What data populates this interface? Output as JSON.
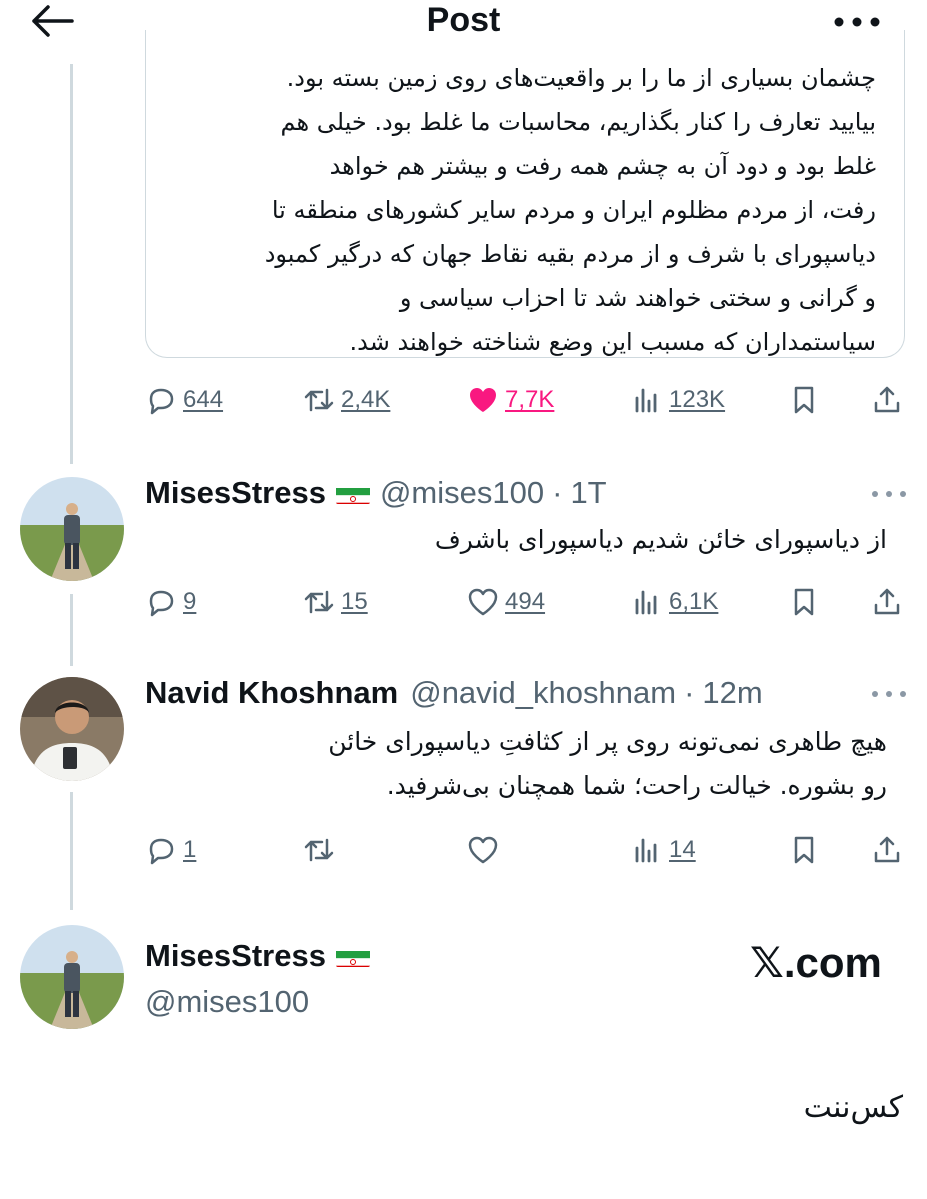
{
  "header": {
    "title": "Post"
  },
  "quoted": {
    "text": "چشمان بسیاری از ما را بر واقعیت‌های روی زمین بسته بود.\nبیایید تعارف را کنار بگذاریم، محاسبات ما غلط بود. خیلی هم\nغلط بود و دود آن به چشم همه رفت و بیشتر هم خواهد\nرفت، از مردم مظلوم ایران و  مردم سایر کشورهای منطقه تا\nدیاسپورای با شرف و از مردم بقیه  نقاط جهان که درگیر کمبود\nو گرانی و سختی خواهند شد تا احزاب سیاسی و\nسیاستمداران که مسبب این وضع شناخته خواهند شد."
  },
  "main_actions": {
    "replies": "644",
    "reposts": "2,4K",
    "likes": "7,7K",
    "views": "123K"
  },
  "tweets": [
    {
      "name": "MisesStress",
      "handle": "@mises100",
      "time": "1T",
      "text": "از دیاسپورای خائن شدیم دیاسپورای باشرف",
      "replies": "9",
      "reposts": "15",
      "likes": "494",
      "views": "6,1K"
    },
    {
      "name": "Navid Khoshnam",
      "handle": "@navid_khoshnam",
      "time": "12m",
      "text": "هیچ طاهری نمی‌تونه روی پر از کثافتِ دیاسپورای خائن\nرو بشوره. خیالت راحت؛ شما همچنان بی‌شرفید.",
      "replies": "1",
      "reposts": "",
      "likes": "",
      "views": "14"
    }
  ],
  "card": {
    "name": "MisesStress",
    "handle": "@mises100",
    "brand": "𝕏.com"
  },
  "bottom_text": "کس‌ننت",
  "colors": {
    "accent_like": "#f91880",
    "secondary": "#536471",
    "border": "#cfd9de"
  }
}
